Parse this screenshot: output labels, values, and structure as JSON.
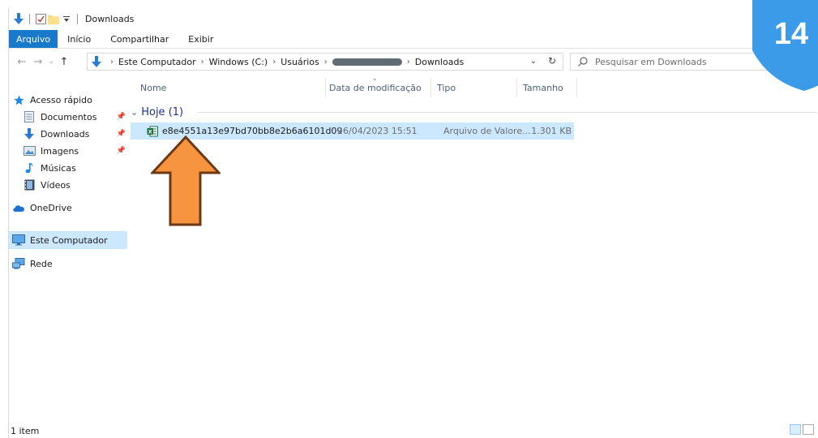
{
  "window": {
    "title": "Downloads"
  },
  "ribbon": {
    "tabs": [
      "Arquivo",
      "Início",
      "Compartilhar",
      "Exibir"
    ]
  },
  "address_bar": {
    "crumbs": [
      "Este Computador",
      "Windows (C:)",
      "Usuários",
      "Downloads"
    ],
    "redacted_segment": true
  },
  "search": {
    "placeholder": "Pesquisar em Downloads"
  },
  "nav_pane": {
    "items": [
      {
        "label": "Acesso rápido",
        "icon": "star-icon",
        "pinned": false
      },
      {
        "label": "Documentos",
        "icon": "document-icon",
        "pinned": true
      },
      {
        "label": "Downloads",
        "icon": "download-arrow-icon",
        "pinned": true
      },
      {
        "label": "Imagens",
        "icon": "image-icon",
        "pinned": true
      },
      {
        "label": "Músicas",
        "icon": "music-note-icon",
        "pinned": false
      },
      {
        "label": "Vídeos",
        "icon": "video-icon",
        "pinned": false
      },
      {
        "label": "OneDrive",
        "icon": "cloud-icon",
        "pinned": false
      },
      {
        "label": "Este Computador",
        "icon": "monitor-icon",
        "pinned": false,
        "selected": true
      },
      {
        "label": "Rede",
        "icon": "network-icon",
        "pinned": false
      }
    ]
  },
  "columns": {
    "name": "Nome",
    "date": "Data de modificação",
    "type": "Tipo",
    "size": "Tamanho"
  },
  "group": {
    "label": "Hoje (1)"
  },
  "files": [
    {
      "name": "e8e4551a13e97bd70bb8e2b6a6101d09",
      "date": "26/04/2023 15:51",
      "type": "Arquivo de Valore...",
      "size": "1.301 KB",
      "icon": "excel-icon"
    }
  ],
  "status": {
    "count": "1 item"
  },
  "badge": {
    "number": "14",
    "color": "#3b9be8"
  },
  "annotation": {
    "arrow_color": "#f6943f",
    "arrow_outline": "#6b3a14"
  }
}
